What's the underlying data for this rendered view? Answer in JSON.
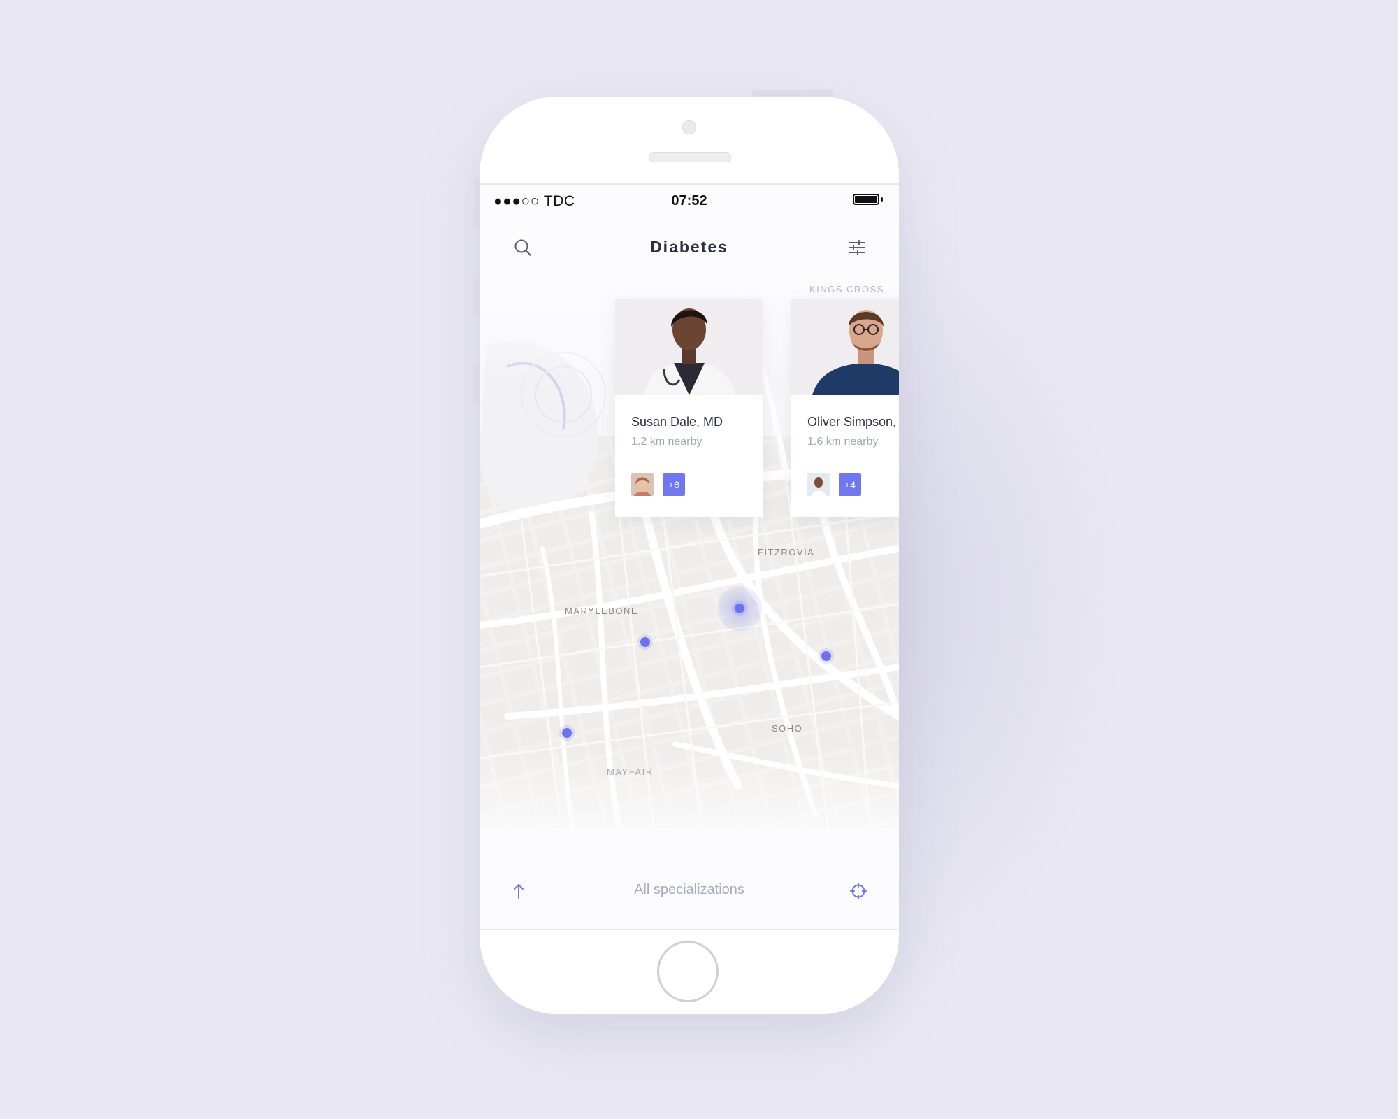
{
  "status_bar": {
    "carrier": "●●●○○ TDC",
    "time": "07:52"
  },
  "header": {
    "title": "Diabetes",
    "left_icon": "search-icon",
    "right_icon": "filter-sliders-icon"
  },
  "doctors": [
    {
      "name": "Susan Dale, MD",
      "distance": "1.2 km nearby",
      "more_count": "+8"
    },
    {
      "name": "Oliver Simpson,",
      "distance": "1.6 km nearby",
      "more_count": "+4"
    }
  ],
  "map": {
    "labels": [
      "KINGS CROSS",
      "FITZROVIA",
      "MARYLEBONE",
      "SOHO",
      "MAYFAIR"
    ],
    "pin_color": "#6a72ee"
  },
  "bottom_bar": {
    "label": "All specializations",
    "left_icon": "arrow-up-icon",
    "right_icon": "locate-crosshair-icon"
  },
  "colors": {
    "accent": "#6f78ee",
    "background": "#e9e8f2",
    "title": "#2c2c44"
  }
}
